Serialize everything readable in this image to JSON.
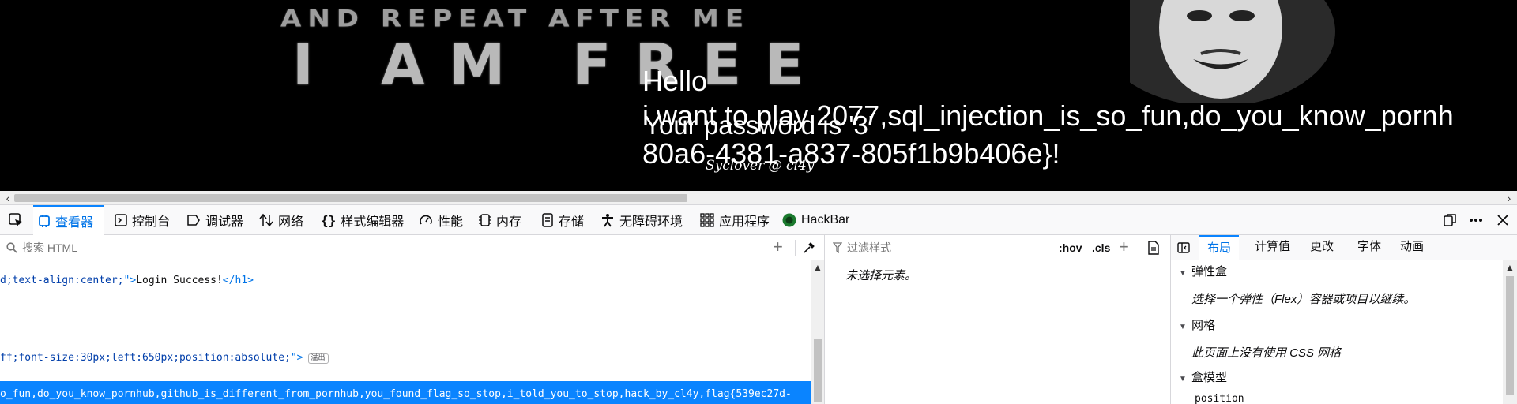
{
  "viewport": {
    "bg_line1": "AND REPEAT AFTER ME",
    "bg_line2": "I AM FREE",
    "overlay": {
      "hello": "Hello",
      "want": "i want to play 2077,sql_injection_is_so_fun,do_you_know_pornh",
      "password": "Your password is '3'",
      "flag": "80a6-4381-a837-805f1b9b406e}!",
      "credit": "Syclover @ cl4y"
    }
  },
  "toolbar": {
    "inspector": "查看器",
    "console": "控制台",
    "debugger": "调试器",
    "network": "网络",
    "style_editor": "样式编辑器",
    "performance": "性能",
    "memory": "内存",
    "storage": "存储",
    "accessibility": "无障碍环境",
    "application": "应用程序",
    "hackbar": "HackBar",
    "accent_color": "#0a84ff"
  },
  "html_pane": {
    "search_placeholder": "搜索 HTML",
    "line1": {
      "style_tail": "d;text-align:center;",
      "text": "Login Success!",
      "close_tag": "h1"
    },
    "line2": {
      "style_tail": "ff;font-size:30px;left:650px;position:absolute;",
      "badge": "溢出"
    },
    "line3": {
      "text": "o_fun,do_you_know_pornhub,github_is_different_from_pornhub,you_found_flag_so_stop,i_told_you_to_stop,hack_by_cl4y,flag{539ec27d-"
    }
  },
  "rules_pane": {
    "filter_placeholder": "过滤样式",
    "hov": ":hov",
    "cls": ".cls",
    "no_element": "未选择元素。"
  },
  "side_pane": {
    "tabs": {
      "layout": "布局",
      "computed": "计算值",
      "changes": "更改",
      "fonts": "字体",
      "animations": "动画"
    },
    "flexbox": {
      "title": "弹性盒",
      "message": "选择一个弹性（Flex）容器或项目以继续。"
    },
    "grid": {
      "title": "网格",
      "message": "此页面上没有使用 CSS 网格"
    },
    "box_model": {
      "title": "盒模型",
      "position_label": "position"
    }
  }
}
